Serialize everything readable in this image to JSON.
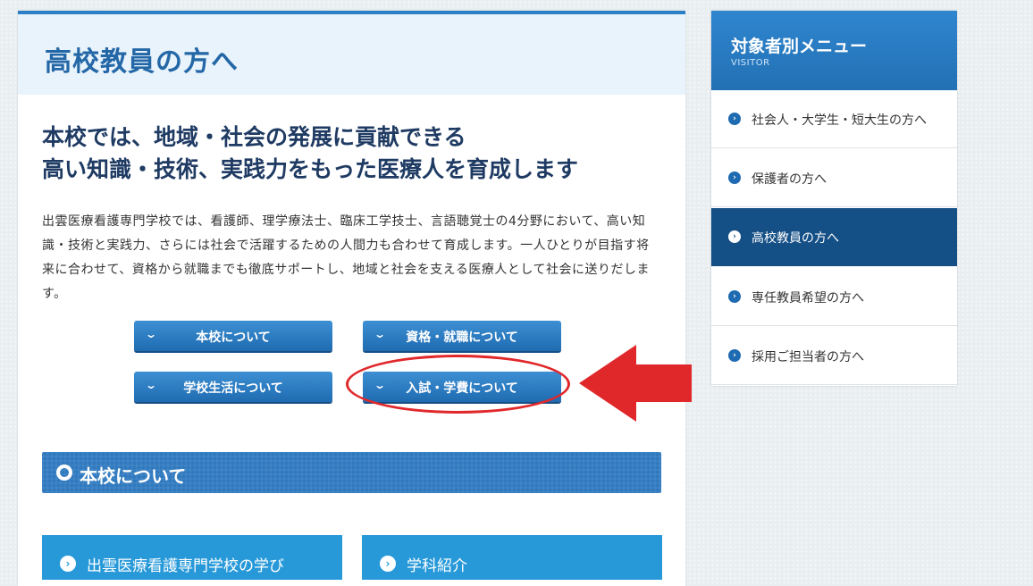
{
  "page": {
    "title": "高校教員の方へ",
    "lead_line1": "本校では、地域・社会の発展に貢献できる",
    "lead_line2": "高い知識・技術、実践力をもった医療人を育成します",
    "body": "出雲医療看護専門学校では、看護師、理学療法士、臨床工学技士、言語聴覚士の4分野において、高い知識・技術と実践力、さらには社会で活躍するための人間力も合わせて育成します。一人ひとりが目指す将来に合わせて、資格から就職までも徹底サポートし、地域と社会を支える医療人として社会に送りだします。"
  },
  "sub_nav": [
    {
      "label": "本校について",
      "icon": "chevron-down-icon"
    },
    {
      "label": "資格・就職について",
      "icon": "chevron-down-icon"
    },
    {
      "label": "学校生活について",
      "icon": "chevron-down-icon"
    },
    {
      "label": "入試・学費について",
      "icon": "chevron-down-icon"
    }
  ],
  "section": {
    "title": "本校について",
    "icon": "ring-icon",
    "cards": [
      {
        "label": "出雲医療看護専門学校の学び",
        "icon": "chevron-right-circle-icon"
      },
      {
        "label": "学科紹介",
        "icon": "chevron-right-circle-icon"
      }
    ]
  },
  "sidebar": {
    "title": "対象者別メニュー",
    "subtitle": "VISITOR",
    "items": [
      {
        "label": "社会人・大学生・短大生の方へ",
        "active": false
      },
      {
        "label": "保護者の方へ",
        "active": false
      },
      {
        "label": "高校教員の方へ",
        "active": true
      },
      {
        "label": "専任教員希望の方へ",
        "active": false
      },
      {
        "label": "採用ご担当者の方へ",
        "active": false
      }
    ]
  },
  "annotation": {
    "highlight_color": "#e0282b",
    "highlight_target": "入試・学費について"
  },
  "colors": {
    "accent": "#2b7fc6",
    "title": "#2467a7",
    "sidebar_active": "#144f86",
    "card": "#2799d9"
  }
}
